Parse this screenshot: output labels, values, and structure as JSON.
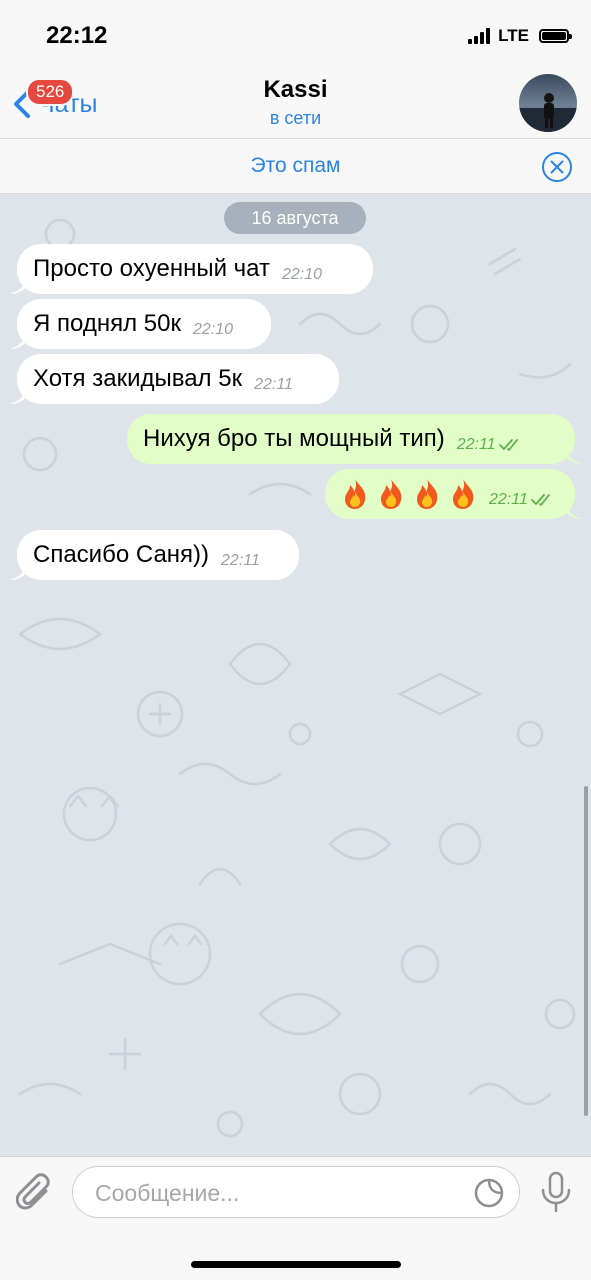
{
  "status_bar": {
    "time": "22:12",
    "network": "LTE"
  },
  "header": {
    "back_label": "Чаты",
    "unread_badge": "526",
    "title": "Kassi",
    "subtitle": "в сети"
  },
  "spam_bar": {
    "label": "Это спам"
  },
  "chat": {
    "date_divider": "16 августа",
    "messages": [
      {
        "direction": "in",
        "text": "Просто охуенный чат",
        "time": "22:10"
      },
      {
        "direction": "in",
        "text": "Я поднял 50к",
        "time": "22:10"
      },
      {
        "direction": "in",
        "text": "Хотя закидывал 5к",
        "time": "22:11"
      },
      {
        "direction": "out",
        "text": "Нихуя бро ты мощный тип)",
        "time": "22:11",
        "status": "read"
      },
      {
        "direction": "out",
        "text": "🔥🔥🔥🔥",
        "time": "22:11",
        "status": "read"
      },
      {
        "direction": "in",
        "text": "Спасибо Саня))",
        "time": "22:11"
      }
    ]
  },
  "composer": {
    "placeholder": "Сообщение..."
  },
  "colors": {
    "accent": "#2b84e4",
    "badge": "#e5483e",
    "outgoing_bubble": "#e1fec6",
    "incoming_bubble": "#ffffff",
    "wallpaper": "#dfe3ea"
  },
  "icons": [
    "back-chevron-icon",
    "close-circle-icon",
    "double-check-icon",
    "fire-emoji-icon",
    "paperclip-icon",
    "sticker-icon",
    "microphone-icon"
  ]
}
